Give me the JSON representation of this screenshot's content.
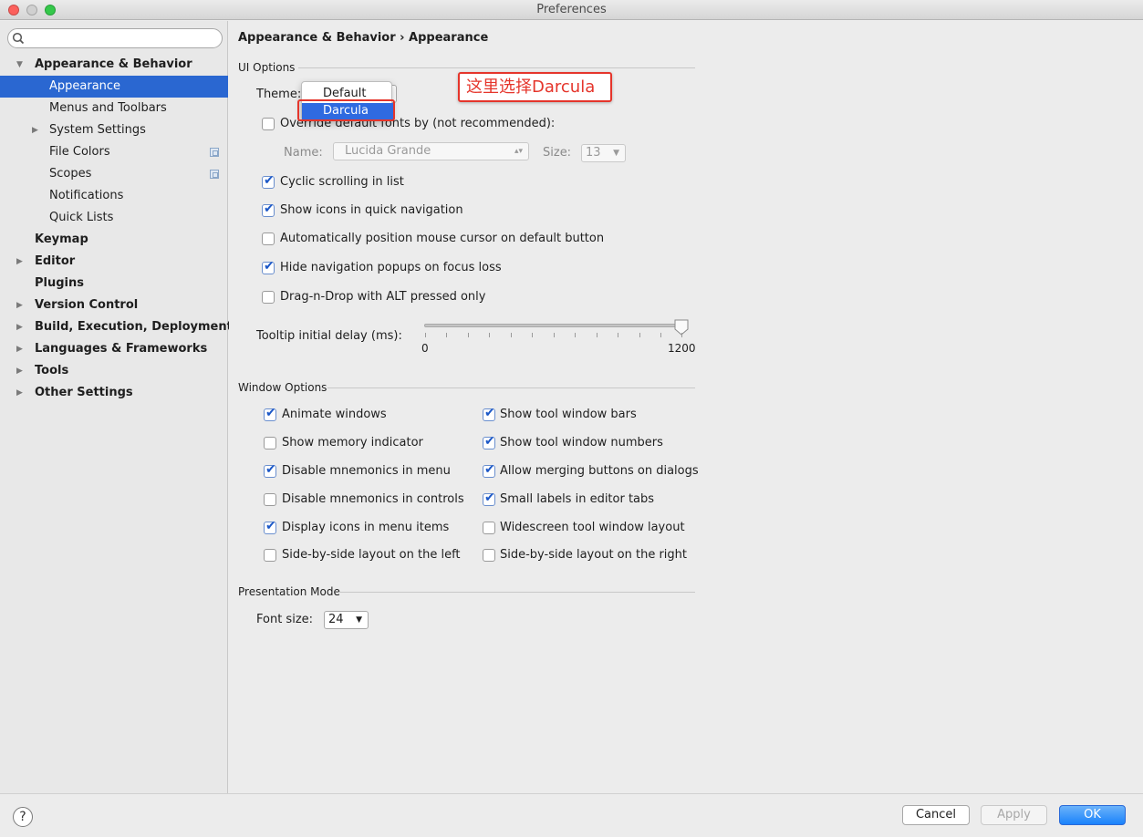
{
  "window": {
    "title": "Preferences"
  },
  "sidebar": {
    "search_placeholder": "",
    "items": [
      {
        "label": "Appearance & Behavior"
      },
      {
        "label": "Appearance"
      },
      {
        "label": "Menus and Toolbars"
      },
      {
        "label": "System Settings"
      },
      {
        "label": "File Colors"
      },
      {
        "label": "Scopes"
      },
      {
        "label": "Notifications"
      },
      {
        "label": "Quick Lists"
      },
      {
        "label": "Keymap"
      },
      {
        "label": "Editor"
      },
      {
        "label": "Plugins"
      },
      {
        "label": "Version Control"
      },
      {
        "label": "Build, Execution, Deployment"
      },
      {
        "label": "Languages & Frameworks"
      },
      {
        "label": "Tools"
      },
      {
        "label": "Other Settings"
      }
    ]
  },
  "breadcrumb": "Appearance & Behavior › Appearance",
  "ui_options": {
    "section_label": "UI Options",
    "theme_label": "Theme:",
    "theme_options": [
      "Default",
      "Darcula"
    ],
    "theme_highlighted": "Darcula",
    "annotation": "这里选择Darcula",
    "override_fonts_label": "Override default fonts by (not recommended):",
    "override_fonts_checked": false,
    "name_label": "Name:",
    "name_value": "Lucida Grande",
    "size_label": "Size:",
    "size_value": "13",
    "checkboxes": [
      {
        "label": "Cyclic scrolling in list",
        "checked": true
      },
      {
        "label": "Show icons in quick navigation",
        "checked": true
      },
      {
        "label": "Automatically position mouse cursor on default button",
        "checked": false
      },
      {
        "label": "Hide navigation popups on focus loss",
        "checked": true
      },
      {
        "label": "Drag-n-Drop with ALT pressed only",
        "checked": false
      }
    ],
    "tooltip_label": "Tooltip initial delay (ms):",
    "tooltip_min": "0",
    "tooltip_max": "1200",
    "tooltip_value": 1200
  },
  "window_options": {
    "section_label": "Window Options",
    "left": [
      {
        "label": "Animate windows",
        "checked": true
      },
      {
        "label": "Show memory indicator",
        "checked": false
      },
      {
        "label": "Disable mnemonics in menu",
        "checked": true
      },
      {
        "label": "Disable mnemonics in controls",
        "checked": false
      },
      {
        "label": "Display icons in menu items",
        "checked": true
      },
      {
        "label": "Side-by-side layout on the left",
        "checked": false
      }
    ],
    "right": [
      {
        "label": "Show tool window bars",
        "checked": true
      },
      {
        "label": "Show tool window numbers",
        "checked": true
      },
      {
        "label": "Allow merging buttons on dialogs",
        "checked": true
      },
      {
        "label": "Small labels in editor tabs",
        "checked": true
      },
      {
        "label": "Widescreen tool window layout",
        "checked": false
      },
      {
        "label": "Side-by-side layout on the right",
        "checked": false
      }
    ]
  },
  "presentation": {
    "section_label": "Presentation Mode",
    "font_size_label": "Font size:",
    "font_size_value": "24"
  },
  "footer": {
    "help": "?",
    "cancel": "Cancel",
    "apply": "Apply",
    "ok": "OK"
  },
  "colors": {
    "selection": "#2a67d1",
    "annotation_red": "#e5352b",
    "primary_button": "#1a82fb"
  }
}
